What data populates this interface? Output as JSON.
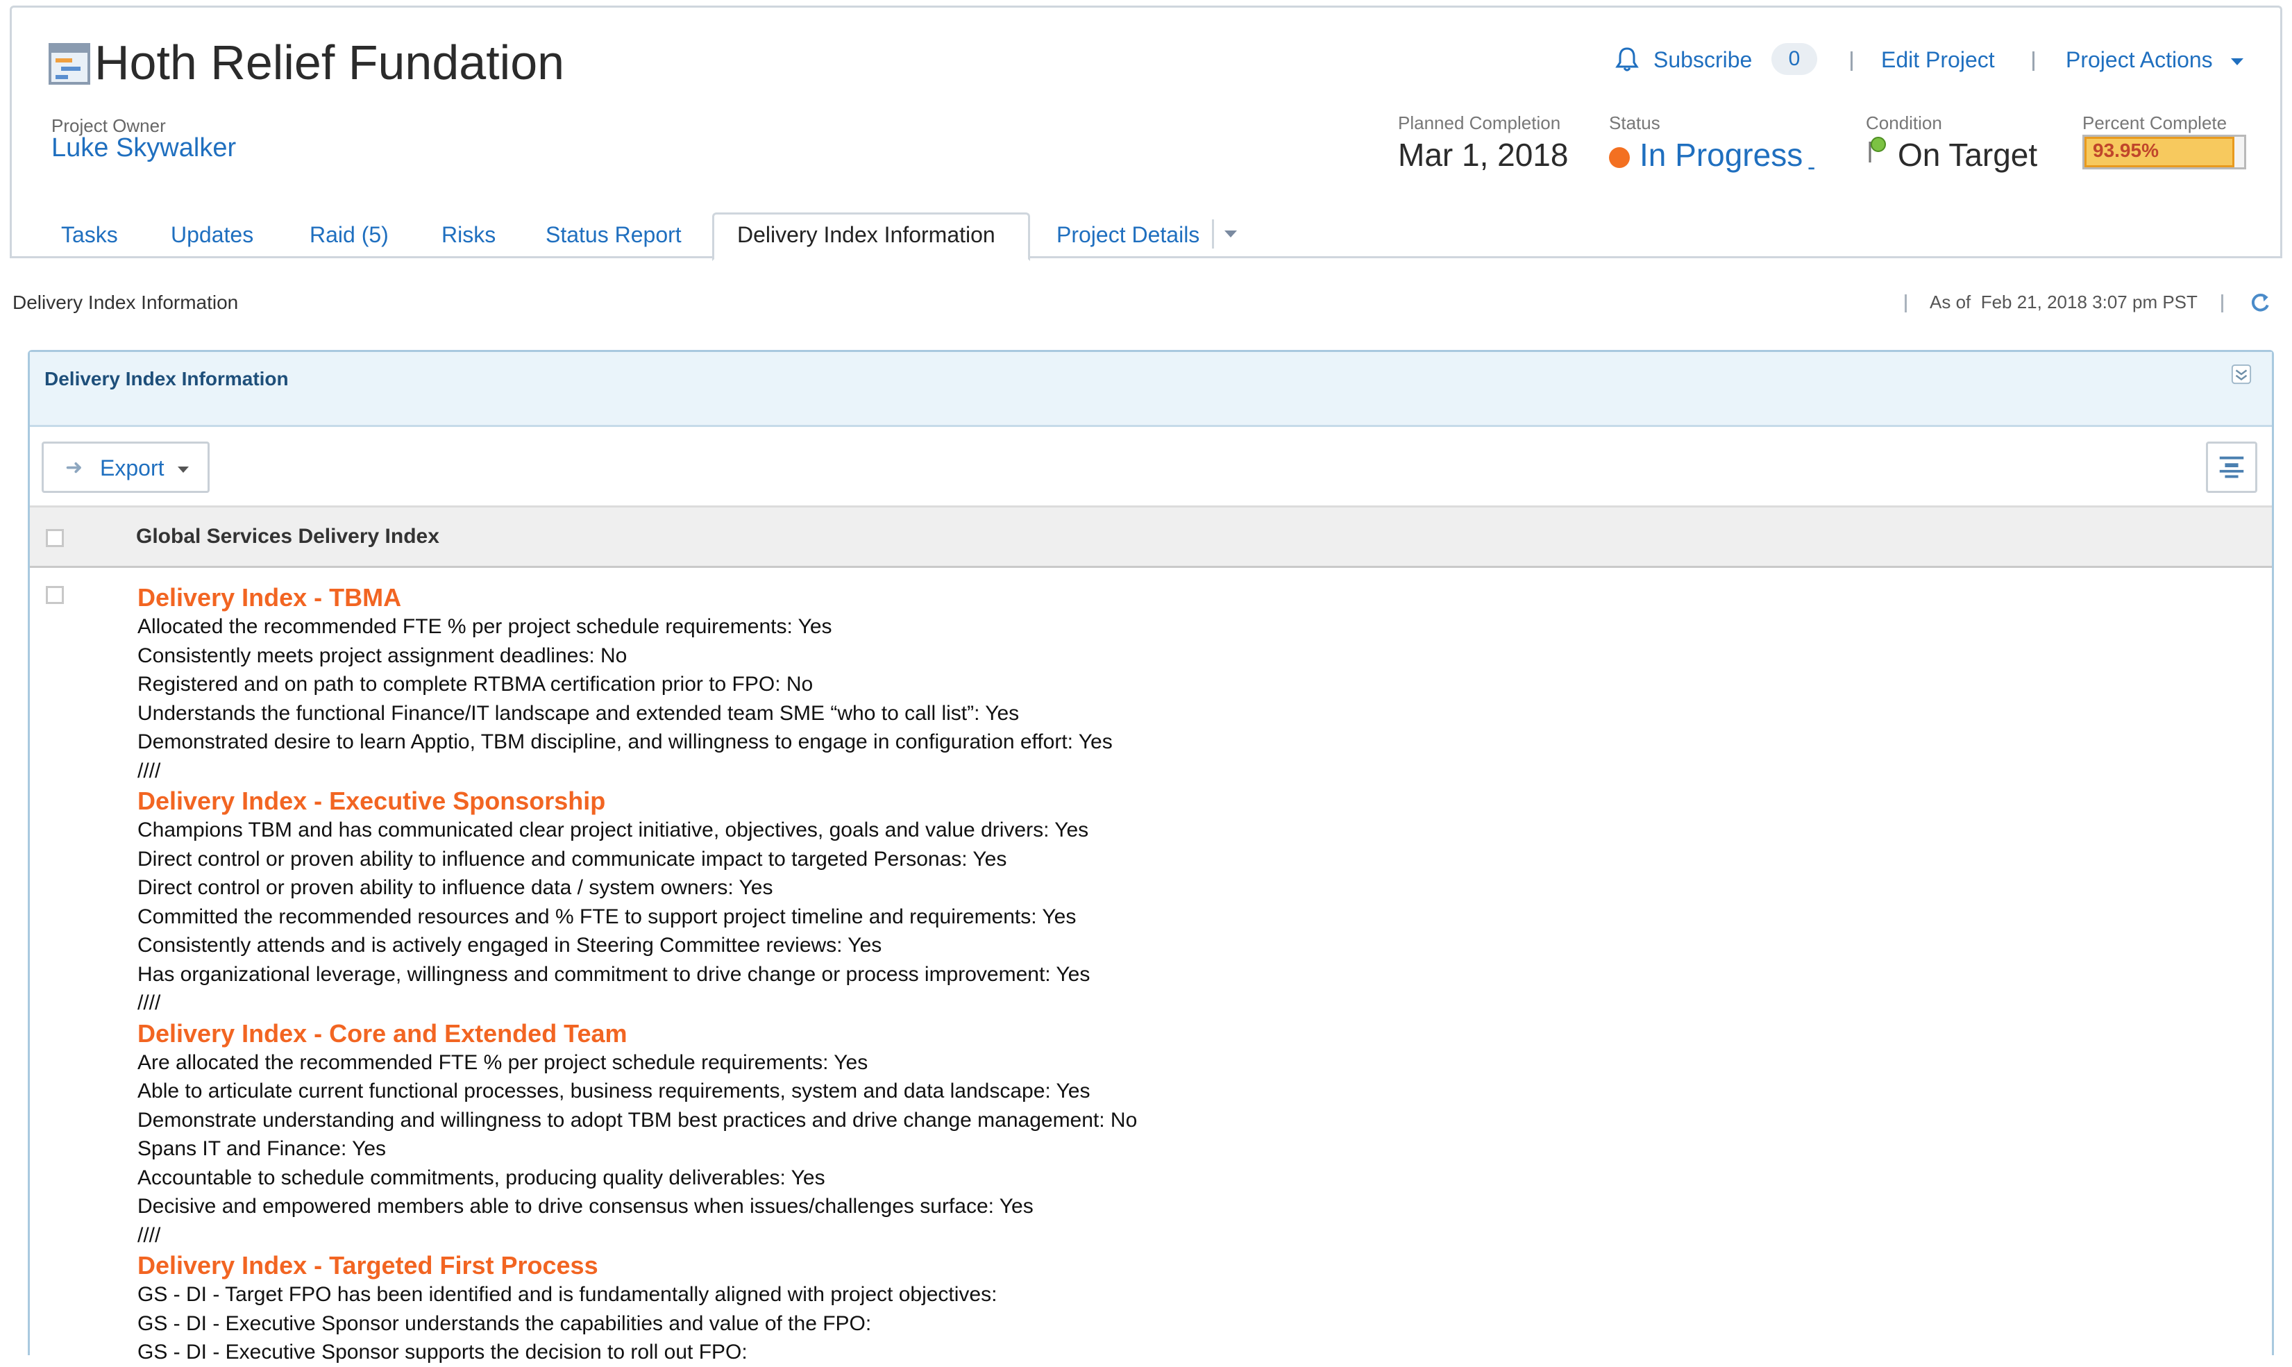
{
  "header": {
    "title": "Hoth Relief Fundation",
    "owner_label": "Project Owner",
    "owner_name": "Luke Skywalker",
    "subscribe_label": "Subscribe",
    "subscribe_count": "0",
    "edit_project": "Edit Project",
    "project_actions": "Project Actions",
    "planned_completion_label": "Planned Completion",
    "planned_completion_value": "Mar 1, 2018",
    "status_label": "Status",
    "status_value": "In Progress",
    "status_caret": "-",
    "condition_label": "Condition",
    "condition_value": "On Target",
    "percent_label": "Percent Complete",
    "percent_value": "93.95%",
    "percent_fraction": 0.9395
  },
  "tabs": [
    {
      "label": "Tasks"
    },
    {
      "label": "Updates"
    },
    {
      "label": "Raid (5)"
    },
    {
      "label": "Risks"
    },
    {
      "label": "Status Report"
    },
    {
      "label": "Delivery Index Information"
    },
    {
      "label": "Project Details"
    }
  ],
  "page": {
    "label": "Delivery Index Information",
    "as_of": "As of  Feb 21, 2018 3:07 pm PST"
  },
  "panel": {
    "title": "Delivery Index Information",
    "export_label": "Export",
    "column_header": "Global Services Delivery Index"
  },
  "sections": [
    {
      "title": "Delivery Index - TBMA",
      "lines": [
        "Allocated the recommended FTE % per project schedule requirements: Yes",
        "Consistently meets project assignment deadlines: No",
        "Registered and on path to complete RTBMA certification prior to FPO: No",
        "Understands the functional Finance/IT landscape and extended team SME “who to call list”: Yes",
        "Demonstrated desire to learn Apptio, TBM discipline, and willingness to engage in configuration effort: Yes",
        "////"
      ]
    },
    {
      "title": "Delivery Index - Executive Sponsorship",
      "lines": [
        "Champions TBM and has communicated clear project initiative, objectives, goals and value drivers: Yes",
        "Direct control or proven ability to influence and communicate impact to targeted Personas: Yes",
        "Direct control or proven ability to influence data / system owners: Yes",
        "Committed the recommended resources and % FTE to support project timeline and requirements: Yes",
        "Consistently attends and is actively engaged in Steering Committee reviews: Yes",
        "Has organizational leverage, willingness and commitment to drive change or process improvement: Yes",
        "////"
      ]
    },
    {
      "title": "Delivery Index - Core and Extended Team",
      "lines": [
        "Are allocated the recommended FTE % per project schedule requirements: Yes",
        "Able to articulate current functional processes, business requirements, system and data landscape: Yes",
        "Demonstrate understanding and willingness to adopt TBM best practices and drive change management: No",
        "Spans IT and Finance: Yes",
        "Accountable to schedule commitments, producing quality deliverables: Yes",
        "Decisive and empowered members able to drive consensus when issues/challenges surface: Yes",
        "////"
      ]
    },
    {
      "title": "Delivery Index - Targeted First Process",
      "lines": [
        "GS - DI - Target FPO has been identified and is fundamentally aligned with project objectives:",
        "GS - DI - Executive Sponsor understands the capabilities and value of the FPO:",
        "GS - DI - Executive Sponsor supports the decision to roll out FPO:"
      ]
    }
  ],
  "colors": {
    "link": "#1f6fbf",
    "section_title": "#f26522",
    "status_dot": "#f37021",
    "percent_fill": "#f7c95e"
  },
  "icons": [
    "project-gantt-icon",
    "bell-icon",
    "condition-flag-icon",
    "refresh-icon",
    "collapse-icon",
    "export-arrow-icon",
    "column-settings-icon"
  ]
}
